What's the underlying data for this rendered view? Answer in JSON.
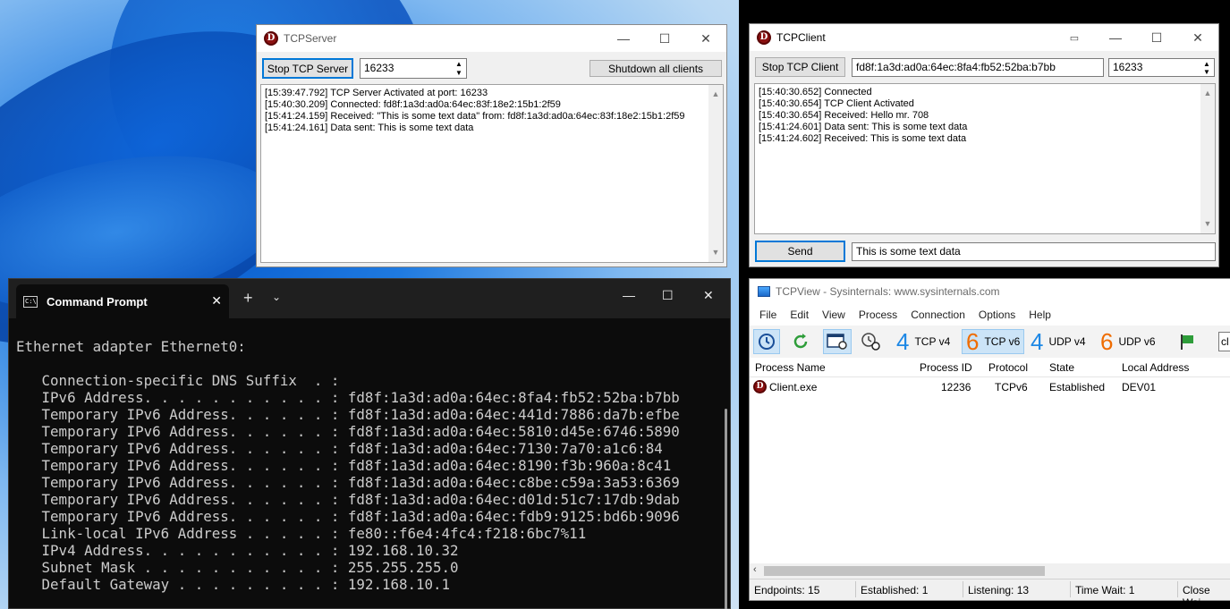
{
  "tcp_server": {
    "title": "TCPServer",
    "stop_label": "Stop TCP Server",
    "port": "16233",
    "shutdown_label": "Shutdown all clients",
    "log": [
      "[15:39:47.792] TCP Server Activated at port: 16233",
      "[15:40:30.209] Connected: fd8f:1a3d:ad0a:64ec:83f:18e2:15b1:2f59",
      "[15:41:24.159] Received: \"This is some text data\" from: fd8f:1a3d:ad0a:64ec:83f:18e2:15b1:2f59",
      "[15:41:24.161] Data sent: This is some text data"
    ]
  },
  "tcp_client": {
    "title": "TCPClient",
    "stop_label": "Stop TCP Client",
    "address": "fd8f:1a3d:ad0a:64ec:8fa4:fb52:52ba:b7bb",
    "port": "16233",
    "log": [
      "[15:40:30.652] Connected",
      "[15:40:30.654] TCP Client Activated",
      "[15:40:30.654] Received: Hello mr. 708",
      "[15:41:24.601] Data sent: This is some text data",
      "[15:41:24.602] Received: This is some text data"
    ],
    "send_label": "Send",
    "message": "This is some text data"
  },
  "cmd": {
    "tab_title": "Command Prompt",
    "lines": [
      "Ethernet adapter Ethernet0:",
      "",
      "   Connection-specific DNS Suffix  . :",
      "   IPv6 Address. . . . . . . . . . . : fd8f:1a3d:ad0a:64ec:8fa4:fb52:52ba:b7bb",
      "   Temporary IPv6 Address. . . . . . : fd8f:1a3d:ad0a:64ec:441d:7886:da7b:efbe",
      "   Temporary IPv6 Address. . . . . . : fd8f:1a3d:ad0a:64ec:5810:d45e:6746:5890",
      "   Temporary IPv6 Address. . . . . . : fd8f:1a3d:ad0a:64ec:7130:7a70:a1c6:84",
      "   Temporary IPv6 Address. . . . . . : fd8f:1a3d:ad0a:64ec:8190:f3b:960a:8c41",
      "   Temporary IPv6 Address. . . . . . : fd8f:1a3d:ad0a:64ec:c8be:c59a:3a53:6369",
      "   Temporary IPv6 Address. . . . . . : fd8f:1a3d:ad0a:64ec:d01d:51c7:17db:9dab",
      "   Temporary IPv6 Address. . . . . . : fd8f:1a3d:ad0a:64ec:fdb9:9125:bd6b:9096",
      "   Link-local IPv6 Address . . . . . : fe80::f6e4:4fc4:f218:6bc7%11",
      "   IPv4 Address. . . . . . . . . . . : 192.168.10.32",
      "   Subnet Mask . . . . . . . . . . . : 255.255.255.0",
      "   Default Gateway . . . . . . . . . : 192.168.10.1"
    ]
  },
  "tcpview": {
    "title": "TCPView - Sysinternals: www.sysinternals.com",
    "menu": [
      "File",
      "Edit",
      "View",
      "Process",
      "Connection",
      "Options",
      "Help"
    ],
    "toolbar": {
      "tcp4_num": "4",
      "tcp4_label": "TCP v4",
      "tcp6_num": "6",
      "tcp6_label": "TCP v6",
      "udp4_num": "4",
      "udp4_label": "UDP v4",
      "udp6_num": "6",
      "udp6_label": "UDP v6",
      "search_partial": "cl"
    },
    "columns": [
      "Process Name",
      "Process ID",
      "Protocol",
      "State",
      "Local Address"
    ],
    "rows": [
      {
        "process": "Client.exe",
        "pid": "12236",
        "protocol": "TCPv6",
        "state": "Established",
        "local": "DEV01"
      }
    ],
    "status": {
      "endpoints": "Endpoints: 15",
      "established": "Established: 1",
      "listening": "Listening: 13",
      "timewait": "Time Wait: 1",
      "closewait": "Close Wai"
    }
  },
  "colors": {
    "accent": "#0078d7",
    "proto_blue": "#1e88e5",
    "proto_orange": "#ef6c00",
    "app_icon": "#8b1111"
  }
}
